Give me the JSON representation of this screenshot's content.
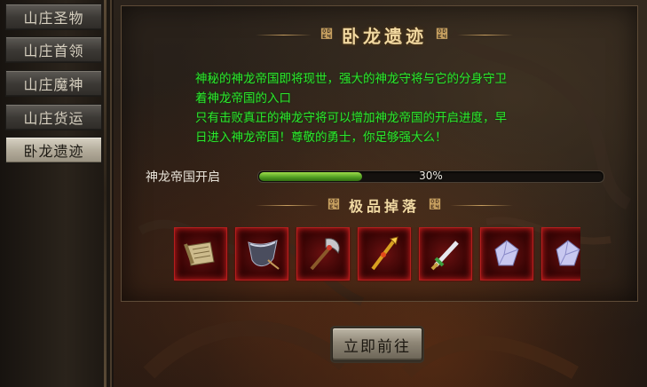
{
  "sidebar": {
    "tabs": [
      {
        "label": "山庄圣物",
        "active": false
      },
      {
        "label": "山庄首领",
        "active": false
      },
      {
        "label": "山庄魔神",
        "active": false
      },
      {
        "label": "山庄货运",
        "active": false
      },
      {
        "label": "卧龙遗迹",
        "active": true
      }
    ]
  },
  "panel": {
    "title": "卧龙遗迹",
    "description": [
      "神秘的神龙帝国即将现世，强大的神龙守将与它的分身守卫",
      "着神龙帝国的入口",
      "只有击败真正的神龙守将可以增加神龙帝国的开启进度，早",
      "日进入神龙帝国！尊敬的勇士，你足够强大么！"
    ],
    "progress": {
      "label": "神龙帝国开启",
      "value": 0.3,
      "text": "30%"
    },
    "drops_title": "极品掉落",
    "drops": [
      {
        "icon": "scroll-icon"
      },
      {
        "icon": "cloth-bag-icon"
      },
      {
        "icon": "battle-axe-icon"
      },
      {
        "icon": "golden-staff-icon"
      },
      {
        "icon": "sword-icon"
      },
      {
        "icon": "crystal-icon"
      },
      {
        "icon": "crystal-icon"
      }
    ],
    "go_button": "立即前往"
  },
  "colors": {
    "description_text": "#2ce62c",
    "progress_fill": "#6fbe30",
    "slot_border": "#b51e1e",
    "title_gold": "#f1d8a0"
  }
}
